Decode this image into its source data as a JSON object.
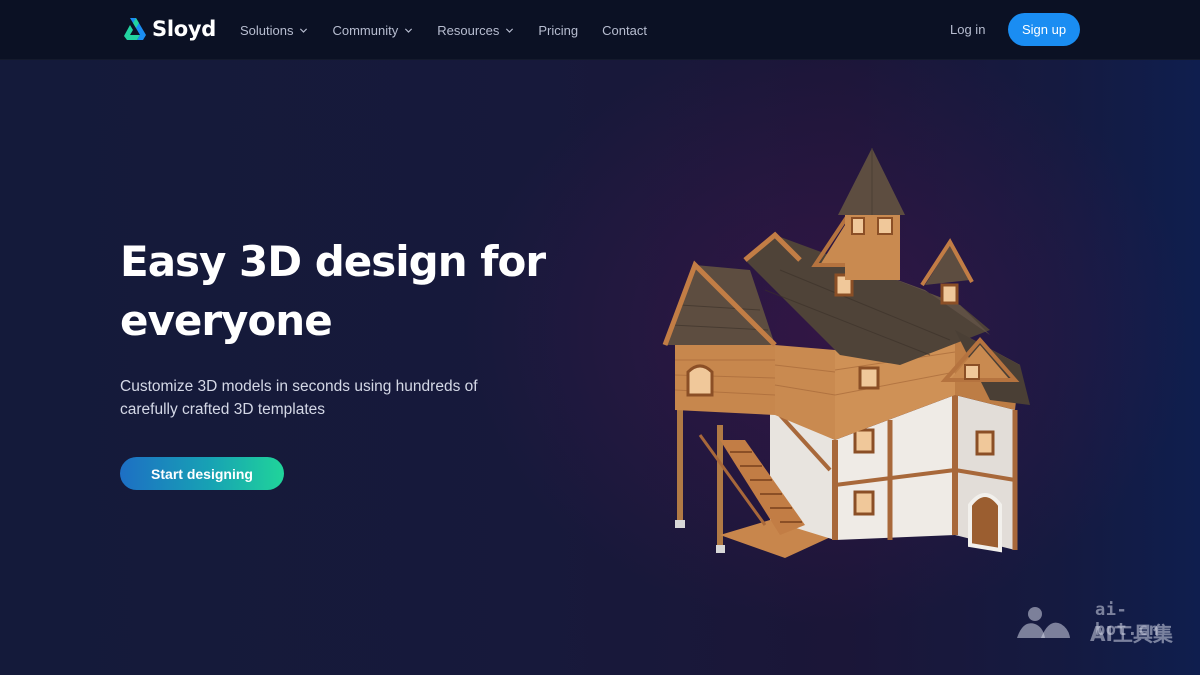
{
  "brand": {
    "name": "Sloyd"
  },
  "nav": {
    "items": [
      {
        "label": "Solutions",
        "has_dropdown": true,
        "icon": "chevron-down-icon"
      },
      {
        "label": "Community",
        "has_dropdown": true,
        "icon": "chevron-down-icon"
      },
      {
        "label": "Resources",
        "has_dropdown": true,
        "icon": "chevron-down-icon"
      },
      {
        "label": "Pricing",
        "has_dropdown": false
      },
      {
        "label": "Contact",
        "has_dropdown": false
      }
    ],
    "login_label": "Log in",
    "signup_label": "Sign up"
  },
  "hero": {
    "title_line1": "Easy 3D design for",
    "title_line2": "everyone",
    "subtitle_line1": "Customize 3D models in seconds using hundreds of",
    "subtitle_line2": "carefully crafted 3D templates",
    "cta_label": "Start designing",
    "image": "3d-medieval-house-model"
  },
  "watermark": {
    "domain": "ai-bot.cn",
    "name": "AI工具集"
  },
  "colors": {
    "nav_bg": "#0b1124",
    "signup_bg": "#1a8df2",
    "cta_gradient_start": "#1d6fc4",
    "cta_gradient_end": "#20d49a",
    "logo_green": "#22d3a0",
    "logo_blue": "#1a8df2"
  }
}
